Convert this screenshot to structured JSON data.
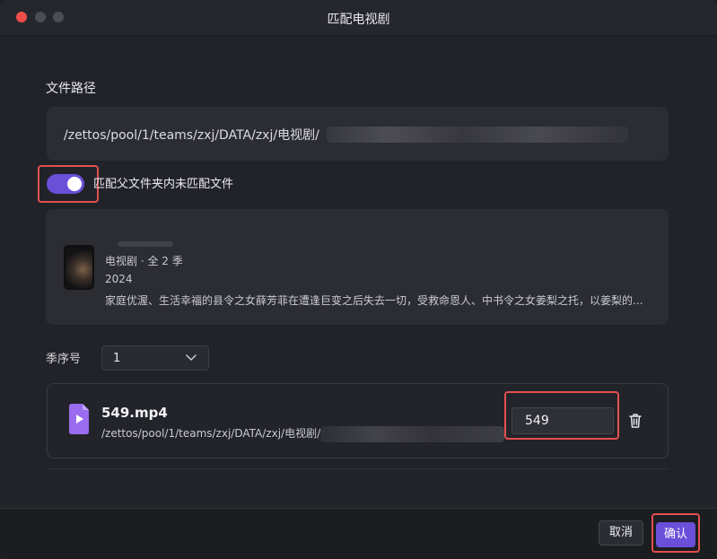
{
  "window": {
    "title": "匹配电视剧"
  },
  "path_section": {
    "label": "文件路径",
    "path": "/zettos/pool/1/teams/zxj/DATA/zxj/电视剧/"
  },
  "toggle": {
    "label": "匹配父文件夹内未匹配文件",
    "on": true
  },
  "show": {
    "meta": "电视剧 · 全 2 季",
    "year": "2024",
    "description": "家庭优渥、生活幸福的县令之女薛芳菲在遭逢巨变之后失去一切，受救命恩人、中书令之女姜梨之托，以姜梨的..."
  },
  "season": {
    "label": "季序号",
    "selected": "1"
  },
  "file": {
    "name": "549.mp4",
    "path": "/zettos/pool/1/teams/zxj/DATA/zxj/电视剧/",
    "episode_value": "549"
  },
  "footer": {
    "cancel_label": "取消",
    "confirm_label": "确认"
  },
  "colors": {
    "accent": "#6a4fd9",
    "highlight": "#e35050",
    "file_icon": "#9b6cf0"
  }
}
